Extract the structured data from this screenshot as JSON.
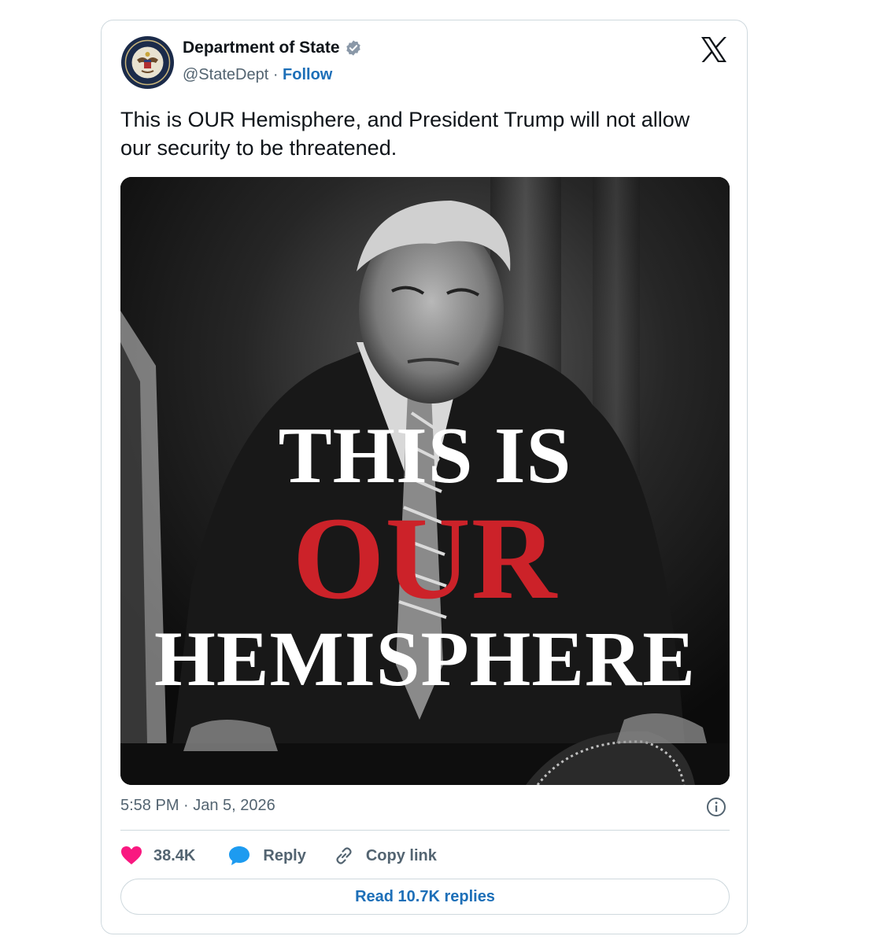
{
  "account": {
    "display_name": "Department of State",
    "handle": "@StateDept",
    "separator": "·",
    "follow_label": "Follow",
    "verified": true
  },
  "tweet": {
    "text": "This is OUR Hemisphere, and President Trump will not allow our security to be threatened.",
    "timestamp": "5:58 PM · Jan 5, 2026"
  },
  "media": {
    "line1": "THIS IS",
    "line2": "OUR",
    "line3": "HEMISPHERE"
  },
  "actions": {
    "like_count": "38.4K",
    "reply_label": "Reply",
    "copy_link_label": "Copy link"
  },
  "read_replies_label": "Read 10.7K replies",
  "icons": {
    "brand": "x-logo-icon",
    "verified": "verified-badge-icon",
    "like": "heart-icon",
    "reply": "speech-bubble-icon",
    "copy": "link-icon",
    "info": "info-icon"
  },
  "colors": {
    "accent": "#1d6fb8",
    "like": "#f91880",
    "reply": "#1d9bf0",
    "media_highlight": "#cc2229",
    "muted_text": "#536471",
    "border": "#cfd9de"
  }
}
